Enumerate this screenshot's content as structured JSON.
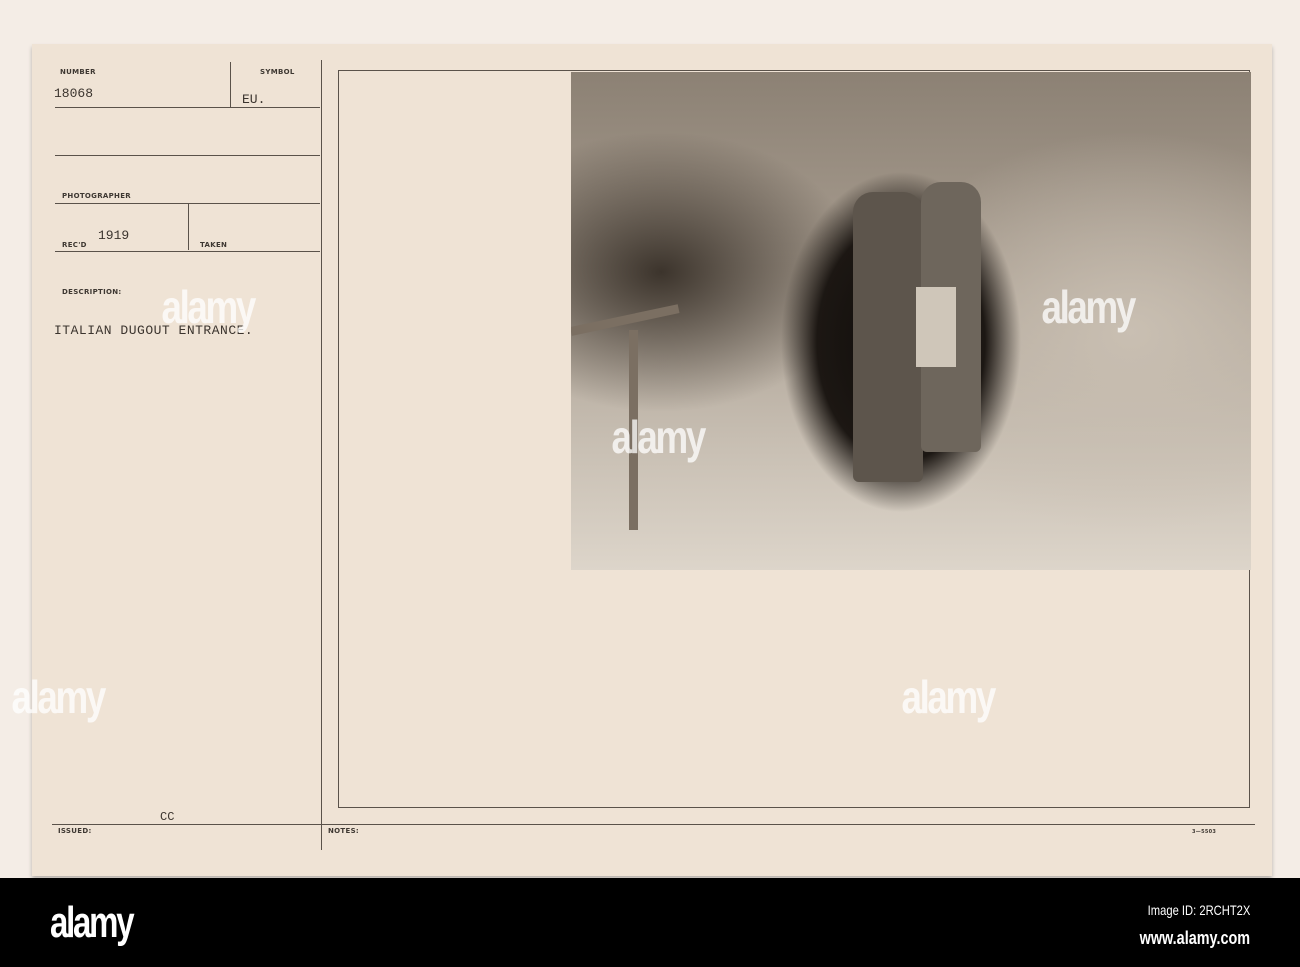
{
  "card": {
    "number_label": "NUMBER",
    "number_value": "18068",
    "symbol_label": "SYMBOL",
    "symbol_value": "EU.",
    "photographer_label": "PHOTOGRAPHER",
    "recd_label": "REC'D",
    "recd_value": "1919",
    "taken_label": "TAKEN",
    "description_label": "DESCRIPTION:",
    "description_value": "ITALIAN DUGOUT ENTRANCE.",
    "issued_label": "ISSUED:",
    "issued_value": "CC",
    "notes_label": "NOTES:",
    "form_code": "3—5503"
  },
  "photo": {
    "subject": "photograph",
    "tone": "sepia"
  },
  "watermark": {
    "text": "alamy"
  },
  "footer": {
    "brand": "alamy",
    "image_id": "Image ID: 2RCHT2X",
    "url": "www.alamy.com"
  }
}
